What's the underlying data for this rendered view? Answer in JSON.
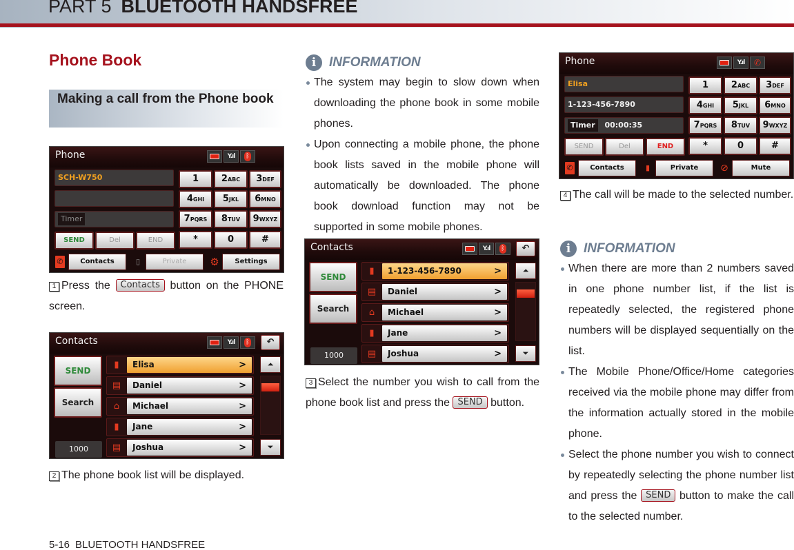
{
  "header": {
    "part": "PART 5",
    "title": "BLUETOOTH HANDSFREE"
  },
  "section_title": "Phone Book",
  "subsection_title": "Making a call from the Phone book",
  "phone_screen": {
    "title": "Phone",
    "device_name": "SCH-W750",
    "line2": "",
    "timer_label": "Timer",
    "timer_value": "",
    "keypad": [
      {
        "digit": "1",
        "letters": ""
      },
      {
        "digit": "2",
        "letters": "ABC"
      },
      {
        "digit": "3",
        "letters": "DEF"
      },
      {
        "digit": "4",
        "letters": "GHI"
      },
      {
        "digit": "5",
        "letters": "JKL"
      },
      {
        "digit": "6",
        "letters": "MNO"
      },
      {
        "digit": "7",
        "letters": "PQRS"
      },
      {
        "digit": "8",
        "letters": "TUV"
      },
      {
        "digit": "9",
        "letters": "WXYZ"
      },
      {
        "digit": "*",
        "letters": ""
      },
      {
        "digit": "0",
        "letters": ""
      },
      {
        "digit": "#",
        "letters": ""
      }
    ],
    "send_label": "SEND",
    "del_label": "Del",
    "end_label": "END",
    "bottom": [
      "Contacts",
      "Private",
      "Settings"
    ]
  },
  "contacts_screen_1": {
    "title": "Contacts",
    "back_icon": "return-icon",
    "send_label": "SEND",
    "search_label": "Search",
    "count": "1000",
    "rows": [
      {
        "name": "Elisa",
        "type": "mobile",
        "selected": true
      },
      {
        "name": "Daniel",
        "type": "office",
        "selected": false
      },
      {
        "name": "Michael",
        "type": "home",
        "selected": false
      },
      {
        "name": "Jane",
        "type": "mobile",
        "selected": false
      },
      {
        "name": "Joshua",
        "type": "office",
        "selected": false
      }
    ]
  },
  "contacts_screen_2": {
    "title": "Contacts",
    "send_label": "SEND",
    "search_label": "Search",
    "count": "1000",
    "rows": [
      {
        "name": "1-123-456-7890",
        "type": "mobile",
        "selected": true
      },
      {
        "name": "Daniel",
        "type": "office",
        "selected": false
      },
      {
        "name": "Michael",
        "type": "home",
        "selected": false
      },
      {
        "name": "Jane",
        "type": "mobile",
        "selected": false
      },
      {
        "name": "Joshua",
        "type": "office",
        "selected": false
      }
    ]
  },
  "call_screen": {
    "title": "Phone",
    "contact_name": "Elisa",
    "number": "1-123-456-7890",
    "timer_label": "Timer",
    "timer_value": "00:00:35",
    "send_label": "SEND",
    "del_label": "Del",
    "end_label": "END",
    "bottom": [
      "Contacts",
      "Private",
      "Mute"
    ]
  },
  "steps": {
    "s1_num": "1",
    "s1_pre": "Press the ",
    "s1_btn": "Contacts",
    "s1_post": " button on the PHONE screen.",
    "s2_num": "2",
    "s2": "The phone book list will be displayed.",
    "s3_num": "3",
    "s3_pre": "Select the number you wish to call from the phone book list and press the ",
    "s3_btn": "SEND",
    "s3_post": " button.",
    "s4_num": "4",
    "s4": "The call will be made to the selected number."
  },
  "info1": {
    "title": "INFORMATION",
    "bullets": [
      "The system may begin to slow down when downloading the phone book in some mobile phones.",
      "Upon connecting a mobile phone, the phone book lists saved in the mobile phone will automatically be downloaded. The phone book download function may not be supported in some mobile phones."
    ]
  },
  "info2": {
    "title": "INFORMATION",
    "b1": "When there are more than 2 numbers saved in one phone number list, if the list is repeatedly selected, the registered phone numbers will be displayed sequentially on the list.",
    "b2": "The Mobile Phone/Office/Home categories received via the mobile phone may differ from the information actually stored in the mobile phone.",
    "b3_pre": "Select the phone number you wish to connect by repeatedly selecting the phone number list and press the ",
    "b3_btn": "SEND",
    "b3_post": " button to make the call to the selected number."
  },
  "footer": {
    "page": "5-16",
    "section": "BLUETOOTH HANDSFREE"
  }
}
